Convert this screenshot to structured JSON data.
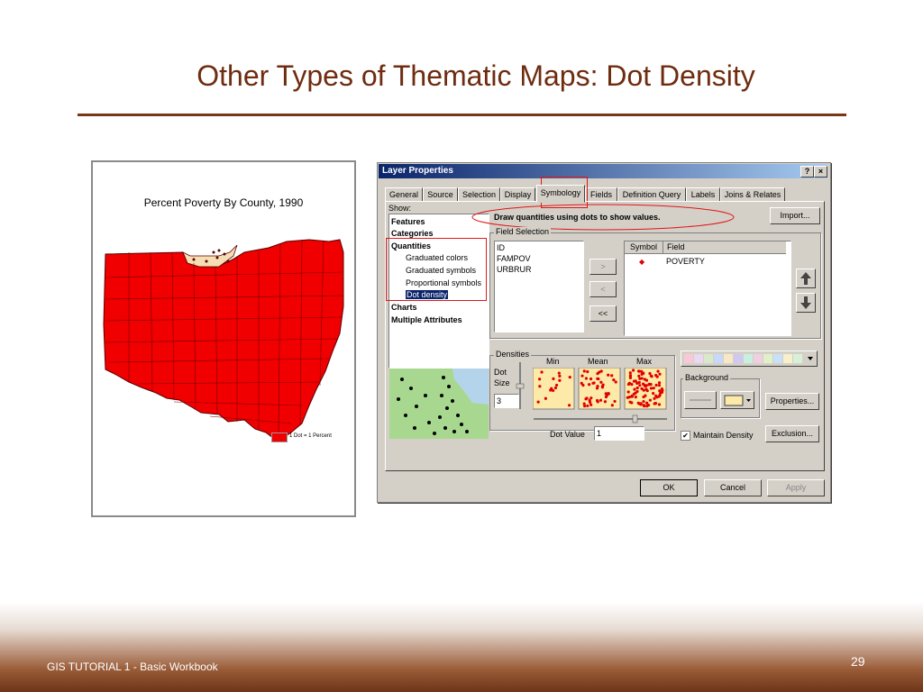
{
  "slide": {
    "title": "Other Types of Thematic Maps: Dot Density",
    "footer": "GIS TUTORIAL 1 - Basic Workbook",
    "page_number": "29"
  },
  "map": {
    "title": "Percent Poverty By County, 1990",
    "legend_label": "1 Dot = 1 Percent",
    "fill_color": "#f00000",
    "lake_color": "#f5deb3"
  },
  "dialog": {
    "title": "Layer Properties",
    "help_button": "?",
    "close_button": "×",
    "tabs": [
      "General",
      "Source",
      "Selection",
      "Display",
      "Symbology",
      "Fields",
      "Definition Query",
      "Labels",
      "Joins & Relates"
    ],
    "active_tab": "Symbology",
    "show_label": "Show:",
    "show_items": [
      {
        "label": "Features",
        "bold": true
      },
      {
        "label": "Categories",
        "bold": true
      },
      {
        "label": "Quantities",
        "bold": true
      },
      {
        "label": "Graduated colors",
        "bold": false
      },
      {
        "label": "Graduated symbols",
        "bold": false
      },
      {
        "label": "Proportional symbols",
        "bold": false
      },
      {
        "label": "Dot density",
        "bold": false,
        "selected": true
      },
      {
        "label": "Charts",
        "bold": true
      },
      {
        "label": "Multiple Attributes",
        "bold": true
      }
    ],
    "description": "Draw quantities using dots to show values.",
    "import_button": "Import...",
    "field_selection_label": "Field Selection",
    "fields": [
      "ID",
      "FAMPOV",
      "URBRUR"
    ],
    "move_right_button": ">",
    "move_left_button": "<",
    "remove_all_button": "<<",
    "symbol_col": "Symbol",
    "field_col": "Field",
    "selected_fields": [
      {
        "symbol": "◆",
        "field": "POVERTY"
      }
    ],
    "densities_label": "Densities",
    "dot_size_label": "Dot Size",
    "dot_size_value": "3",
    "min_label": "Min",
    "mean_label": "Mean",
    "max_label": "Max",
    "dot_value_label": "Dot Value",
    "dot_value": "1",
    "background_label": "Background",
    "properties_button": "Properties...",
    "exclusion_button": "Exclusion...",
    "maintain_density_label": "Maintain Density",
    "maintain_density_checked": "✔",
    "ok_button": "OK",
    "cancel_button": "Cancel",
    "apply_button": "Apply",
    "dot_color": "#e00000",
    "swatch_bg_color": "#fde9a8"
  }
}
